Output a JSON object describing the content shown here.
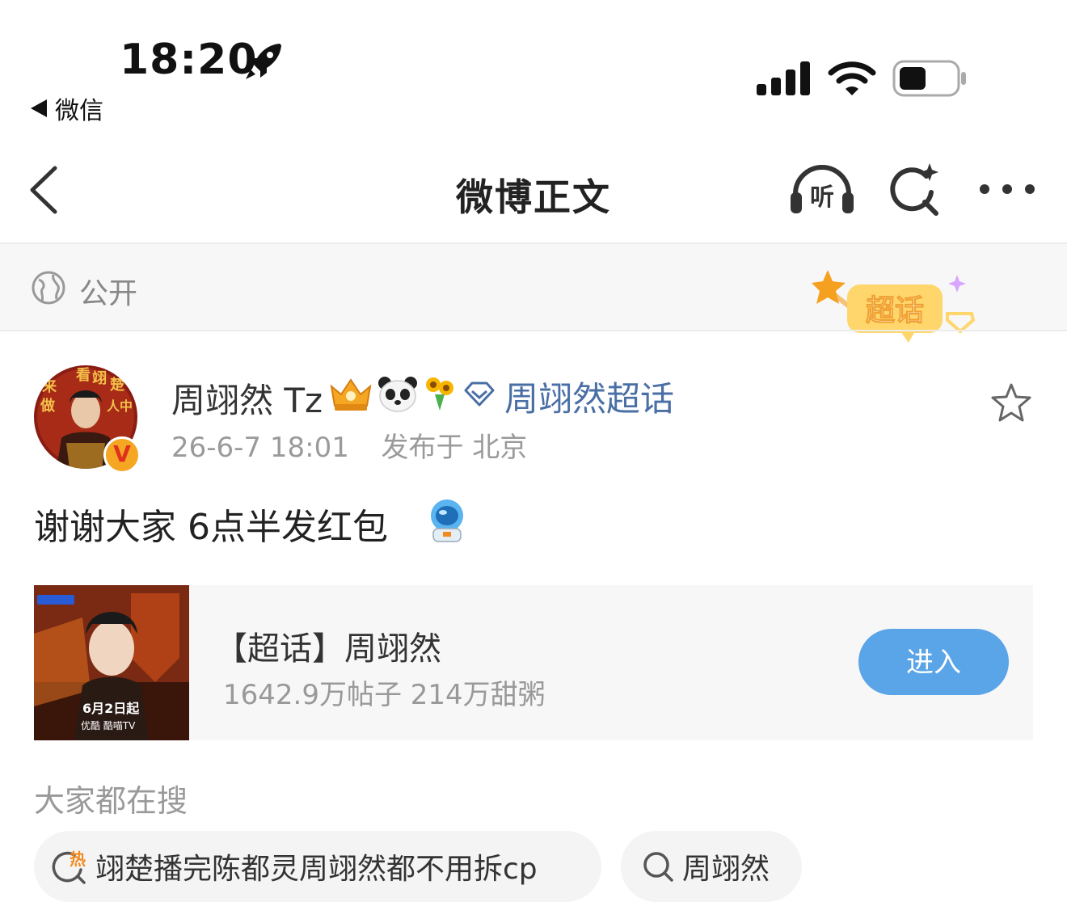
{
  "status_bar": {
    "time": "18:20",
    "back_app_label": "微信"
  },
  "nav": {
    "title": "微博正文",
    "listen_icon_text": "听"
  },
  "visibility": {
    "label": "公开",
    "badge_text": "超话"
  },
  "post": {
    "author": "周翊然 Tz",
    "topic_link": "周翊然超话",
    "timestamp": "26-6-7 18:01",
    "location": "发布于 北京",
    "text": "谢谢大家 6点半发红包",
    "verified_mark": "V",
    "avatar_text": [
      "来",
      "看",
      "翊",
      "楚",
      "做",
      "人",
      "中"
    ]
  },
  "topic_card": {
    "title": "【超话】周翊然",
    "stats": "1642.9万帖子 214万甜粥",
    "enter_label": "进入",
    "poster_date": "6月2日起",
    "poster_platforms": "优酷 酷喵TV"
  },
  "search": {
    "heading": "大家都在搜",
    "hot_icon_text": "热",
    "chips": [
      {
        "label": "翊楚播完陈都灵周翊然都不用拆cp"
      },
      {
        "label": "周翊然"
      }
    ]
  },
  "colors": {
    "link_blue": "#4a6fa5",
    "enter_button": "#5aa4e8",
    "hot_orange": "#f28a1f"
  }
}
